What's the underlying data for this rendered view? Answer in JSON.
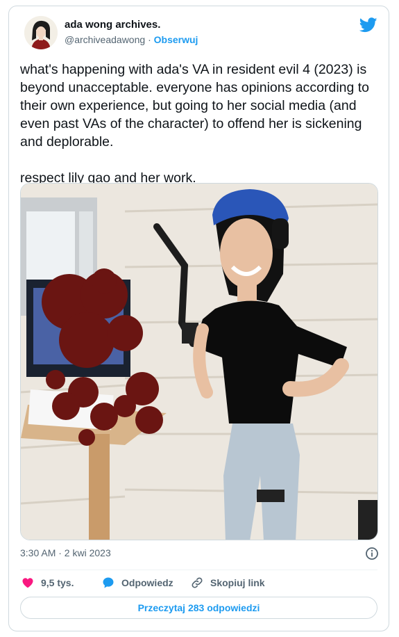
{
  "account": {
    "name": "ada wong archives.",
    "handle": "@archiveadawong",
    "separator": "·",
    "follow_label": "Obserwuj"
  },
  "tweet": {
    "text": "what's happening with ada's VA in resident evil 4 (2023) is beyond unacceptable. everyone has opinions according to their own experience, but going to her social media (and even past VAs of the character) to offend her is sickening and deplorable.\n\nrespect lily gao and her work.",
    "timestamp": "3:30 AM · 2 kwi 2023"
  },
  "actions": {
    "likes": "9,5 tys.",
    "reply_label": "Odpowiedz",
    "copy_link_label": "Skopiuj link",
    "read_replies_label": "Przeczytaj 283 odpowiedzi"
  },
  "colors": {
    "accent": "#1d9bf0",
    "like": "#f91880",
    "muted": "#536471"
  },
  "icons": {
    "brand": "twitter-bird-icon",
    "info": "info-icon",
    "like": "heart-icon",
    "reply": "speech-bubble-icon",
    "copy_link": "link-icon"
  }
}
